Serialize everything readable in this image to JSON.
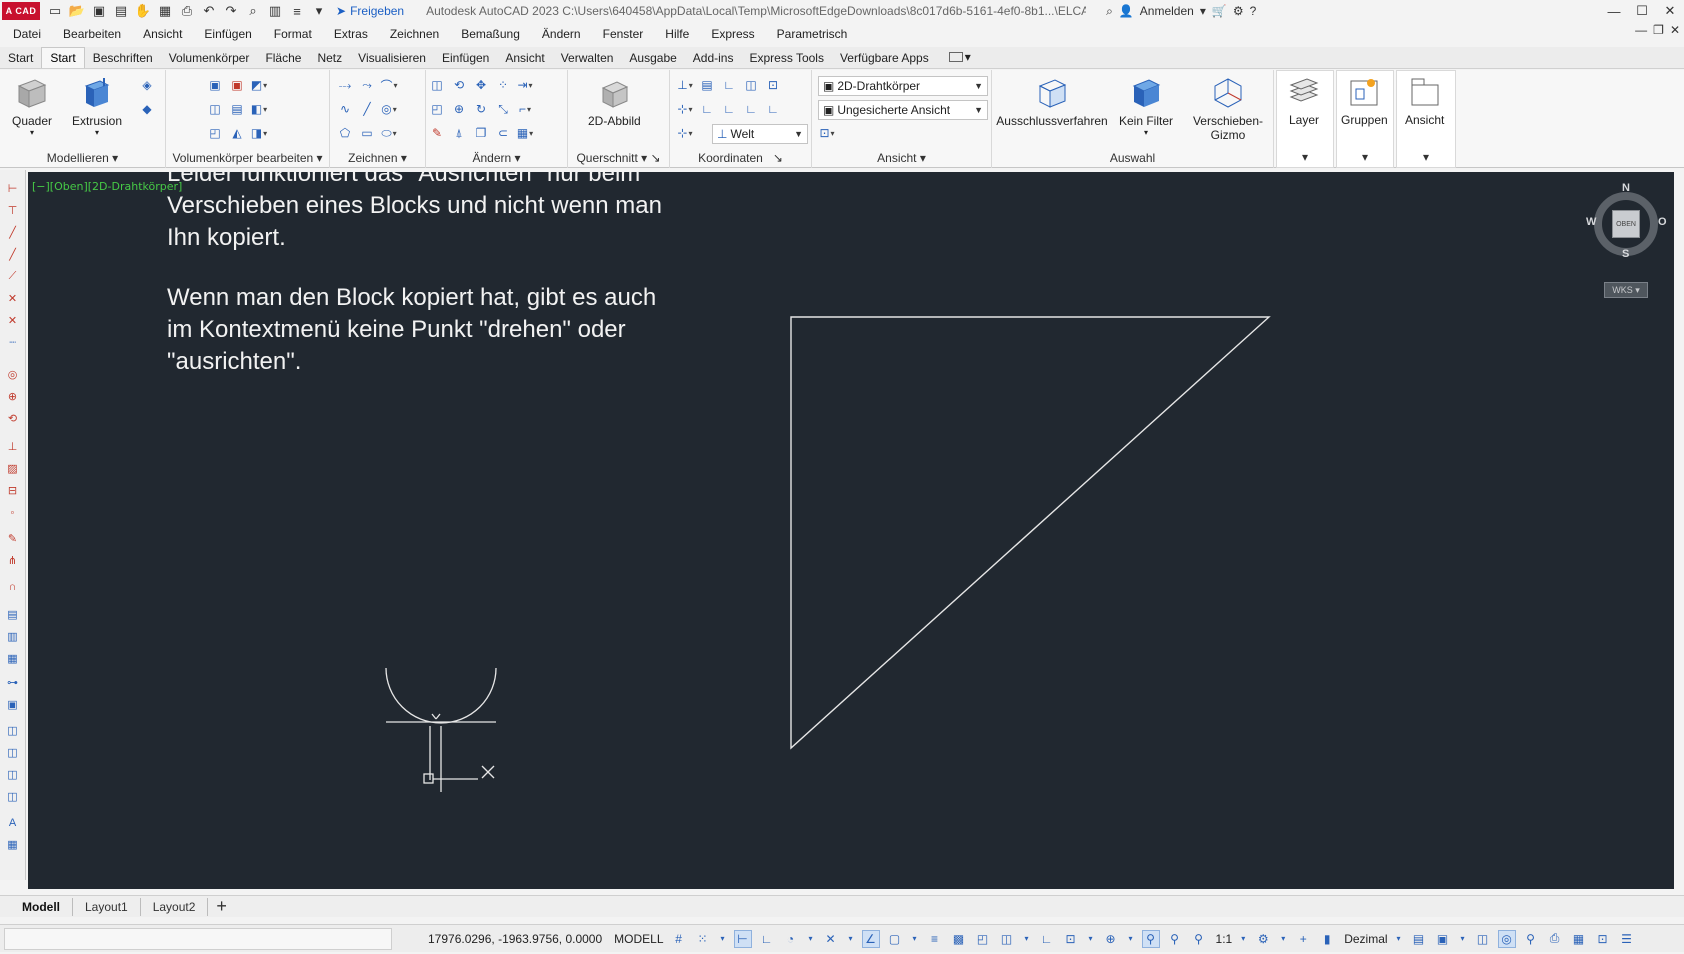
{
  "app": {
    "logo_text": "A CAD",
    "title": "Autodesk AutoCAD 2023    C:\\Users\\640458\\AppData\\Local\\Temp\\MicrosoftEdgeDownloads\\8c017d6b-5161-4ef0-8b1...\\ELCAD_Bloc_Ausrichten.dwg",
    "share_label": "Freigeben",
    "signin_label": "Anmelden"
  },
  "menu": [
    "Datei",
    "Bearbeiten",
    "Ansicht",
    "Einfügen",
    "Format",
    "Extras",
    "Zeichnen",
    "Bemaßung",
    "Ändern",
    "Fenster",
    "Hilfe",
    "Express",
    "Parametrisch"
  ],
  "ribbon_tabs": [
    "Start",
    "Start",
    "Beschriften",
    "Volumenkörper",
    "Fläche",
    "Netz",
    "Visualisieren",
    "Einfügen",
    "Ansicht",
    "Verwalten",
    "Ausgabe",
    "Add-ins",
    "Express Tools",
    "Verfügbare Apps"
  ],
  "ribbon_active_tab": 1,
  "ribbon": {
    "quader": "Quader",
    "extrusion": "Extrusion",
    "modellieren": "Modellieren",
    "vol_bearbeiten": "Volumenkörper bearbeiten",
    "zeichnen": "Zeichnen",
    "aendern": "Ändern",
    "abbild_2d": "2D-Abbild",
    "querschnitt": "Querschnitt",
    "koordinaten": "Koordinaten",
    "welt": "Welt",
    "visual_style": "2D-Drahtkörper",
    "saved_view": "Ungesicherte Ansicht",
    "ansicht_panel": "Ansicht",
    "ausschluss": "Ausschlussverfahren",
    "kein_filter": "Kein Filter",
    "gizmo": "Verschieben-\nGizmo",
    "auswahl": "Auswahl",
    "layer": "Layer",
    "gruppen": "Gruppen",
    "ansicht_btn": "Ansicht"
  },
  "viewport": {
    "label": "[−][Oben][2D-Drahtkörper]",
    "note_line1": "Leider funktioniert das \"Ausrichten\" nur beim",
    "note_line2": "Verschieben eines Blocks und nicht wenn man\nIhn kopiert.",
    "note_line3": "Wenn man den Block kopiert hat, gibt es auch\nim Kontextmenü keine Punkt \"drehen\" oder\n\"ausrichten\"."
  },
  "navcube": {
    "n": "N",
    "s": "S",
    "w": "W",
    "o": "O",
    "face": "OBEN",
    "wcs": "WKS"
  },
  "layout_tabs": [
    "Modell",
    "Layout1",
    "Layout2"
  ],
  "status": {
    "coords": "17976.0296, -1963.9756, 0.0000",
    "mode": "MODELL",
    "scale": "1:1",
    "units": "Dezimal"
  },
  "colors": {
    "canvas_bg": "#212830",
    "line": "#e6e6e6",
    "viewport_label": "#46c946",
    "logo": "#c8102e"
  }
}
